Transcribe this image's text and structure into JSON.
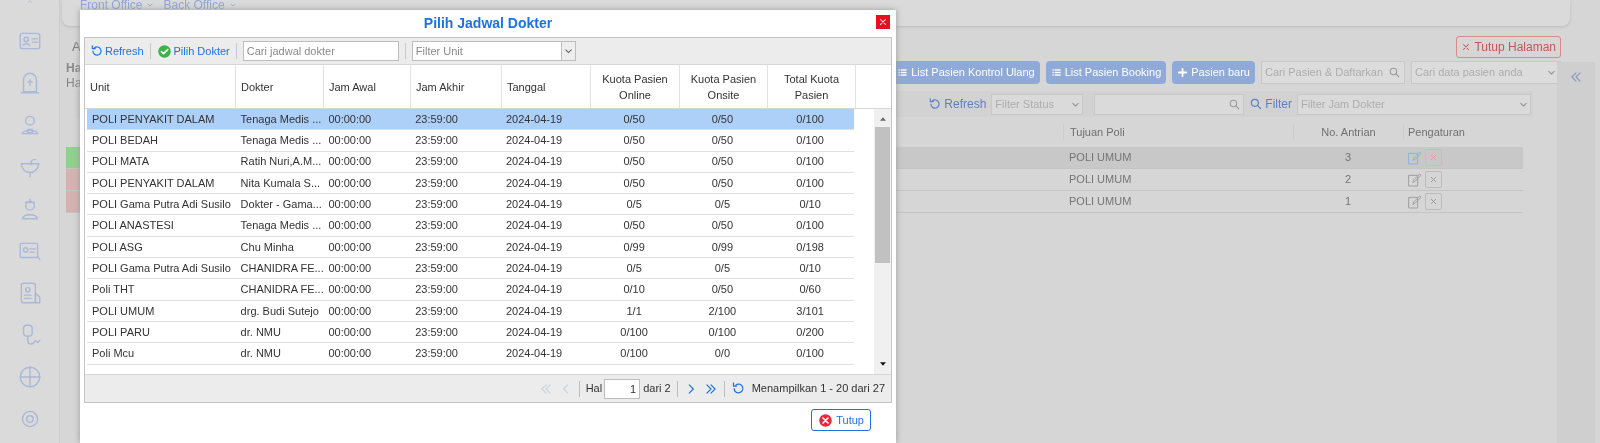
{
  "breadcrumb": [
    "Front Office",
    "Back Office"
  ],
  "page": {
    "fragments": [
      "A",
      "Ha",
      "Ha"
    ],
    "close_page_button": "Tutup Halaman",
    "actions": [
      {
        "kind": "list",
        "label": "List Pasien Kontrol Ulang"
      },
      {
        "kind": "list",
        "label": "List Pasien Booking"
      },
      {
        "kind": "plus",
        "label": "Pasien baru"
      }
    ],
    "search_placeholder": "Cari Pasien & Daftarkan",
    "patient_select_placeholder": "Cari data pasien anda",
    "refresh": "Refresh",
    "filter_status_placeholder": "Filter Status",
    "filter_label": "Filter",
    "filter_jam_placeholder": "Filter Jam Dokter",
    "columns": [
      "Tujuan Poli",
      "No. Antrian",
      "Pengaturan"
    ],
    "rows": [
      {
        "color": "#8fd08f",
        "poli": "POLI UMUM",
        "antrian": "3",
        "selected": true
      },
      {
        "color": "#d4b2b2",
        "poli": "POLI UMUM",
        "antrian": "2",
        "selected": false
      },
      {
        "color": "#d4b2b2",
        "poli": "POLI UMUM",
        "antrian": "1",
        "selected": false
      }
    ]
  },
  "dialog": {
    "title": "Pilih Jadwal Dokter",
    "toolbar": {
      "refresh": "Refresh",
      "pick": "Pilih Dokter",
      "search_placeholder": "Cari jadwal dokter",
      "unit_placeholder": "Filter Unit"
    },
    "columns": [
      "Unit",
      "Dokter",
      "Jam Awal",
      "Jam Akhir",
      "Tanggal",
      "Kuota Pasien Online",
      "Kuota Pasien Onsite",
      "Total Kuota Pasien"
    ],
    "rows": [
      {
        "selected": true,
        "cells": [
          "POLI PENYAKIT DALAM",
          "Tenaga Medis ...",
          "00:00:00",
          "23:59:00",
          "2024-04-19",
          "0/50",
          "0/50",
          "0/100"
        ]
      },
      {
        "selected": false,
        "cells": [
          "POLI BEDAH",
          "Tenaga Medis ...",
          "00:00:00",
          "23:59:00",
          "2024-04-19",
          "0/50",
          "0/50",
          "0/100"
        ]
      },
      {
        "selected": false,
        "cells": [
          "POLI MATA",
          "Ratih Nuri,A.M...",
          "00:00:00",
          "23:59:00",
          "2024-04-19",
          "0/50",
          "0/50",
          "0/100"
        ]
      },
      {
        "selected": false,
        "cells": [
          "POLI PENYAKIT DALAM",
          "Nita Kumala S...",
          "00:00:00",
          "23:59:00",
          "2024-04-19",
          "0/50",
          "0/50",
          "0/100"
        ]
      },
      {
        "selected": false,
        "cells": [
          "POLI Gama Putra Adi Susilo",
          "Dokter - Gama...",
          "00:00:00",
          "23:59:00",
          "2024-04-19",
          "0/5",
          "0/5",
          "0/10"
        ]
      },
      {
        "selected": false,
        "cells": [
          "POLI ANASTESI",
          "Tenaga Medis ...",
          "00:00:00",
          "23:59:00",
          "2024-04-19",
          "0/50",
          "0/50",
          "0/100"
        ]
      },
      {
        "selected": false,
        "cells": [
          "POLI ASG",
          "Chu Minha",
          "00:00:00",
          "23:59:00",
          "2024-04-19",
          "0/99",
          "0/99",
          "0/198"
        ]
      },
      {
        "selected": false,
        "cells": [
          "POLI Gama Putra Adi Susilo",
          "CHANIDRA FE...",
          "00:00:00",
          "23:59:00",
          "2024-04-19",
          "0/5",
          "0/5",
          "0/10"
        ]
      },
      {
        "selected": false,
        "cells": [
          "Poli THT",
          "CHANIDRA FE...",
          "00:00:00",
          "23:59:00",
          "2024-04-19",
          "0/10",
          "0/50",
          "0/60"
        ]
      },
      {
        "selected": false,
        "cells": [
          "POLI UMUM",
          "drg. Budi Sutejo",
          "00:00:00",
          "23:59:00",
          "2024-04-19",
          "1/1",
          "2/100",
          "3/101"
        ]
      },
      {
        "selected": false,
        "cells": [
          "POLI PARU",
          "dr. NMU",
          "00:00:00",
          "23:59:00",
          "2024-04-19",
          "0/100",
          "0/100",
          "0/200"
        ]
      },
      {
        "selected": false,
        "cells": [
          "Poli Mcu",
          "dr. NMU",
          "00:00:00",
          "23:59:00",
          "2024-04-19",
          "0/100",
          "0/0",
          "0/100"
        ]
      }
    ],
    "pager": {
      "first_disabled": true,
      "prev_disabled": true,
      "next_disabled": false,
      "last_disabled": false,
      "page_label": "Hal",
      "page": "1",
      "of": "dari 2",
      "info": "Menampilkan 1 - 20 dari 27"
    },
    "close_button": "Tutup"
  }
}
